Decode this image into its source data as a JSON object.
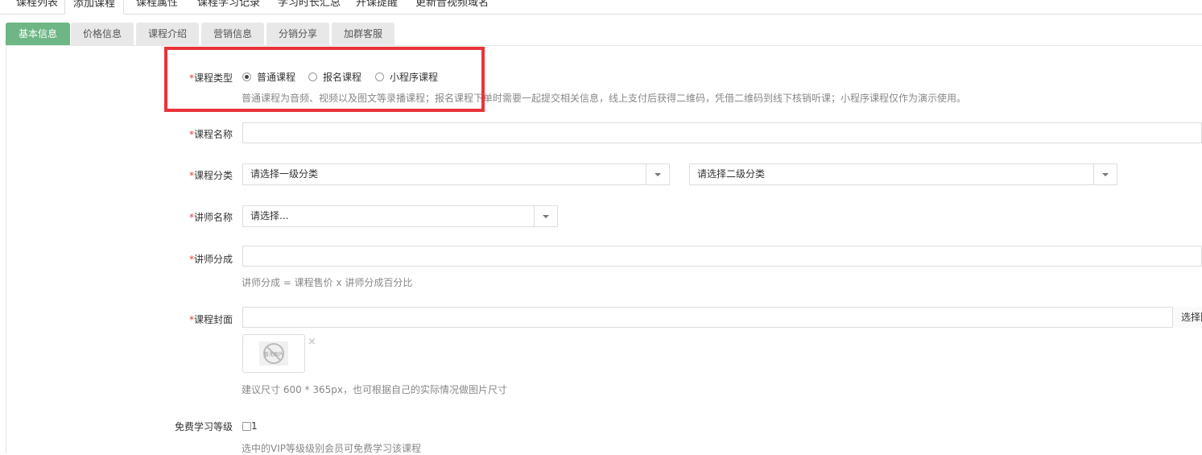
{
  "top_tabs": [
    {
      "label": "课程列表"
    },
    {
      "label": "添加课程"
    },
    {
      "label": "课程属性"
    },
    {
      "label": "课程学习记录"
    },
    {
      "label": "学习时长汇总"
    },
    {
      "label": "开课提醒"
    },
    {
      "label": "更新音视频域名"
    }
  ],
  "sub_tabs": [
    {
      "label": "基本信息"
    },
    {
      "label": "价格信息"
    },
    {
      "label": "课程介绍"
    },
    {
      "label": "营销信息"
    },
    {
      "label": "分销分享"
    },
    {
      "label": "加群客服"
    }
  ],
  "form": {
    "required_mark": "*",
    "course_type": {
      "label": "课程类型",
      "options": [
        "普通课程",
        "报名课程",
        "小程序课程"
      ],
      "selected": "普通课程",
      "help": "普通课程为音频、视频以及图文等录播课程；报名课程下单时需要一起提交相关信息，线上支付后获得二维码，凭借二维码到线下核销听课；小程序课程仅作为演示使用。"
    },
    "course_name": {
      "label": "课程名称",
      "value": ""
    },
    "course_category": {
      "label": "课程分类",
      "level1_placeholder": "请选择一级分类",
      "level2_placeholder": "请选择二级分类"
    },
    "teacher_name": {
      "label": "讲师名称",
      "placeholder": "请选择..."
    },
    "teacher_share": {
      "label": "讲师分成",
      "value": "",
      "help": "讲师分成 = 课程售价 x 讲师分成百分比"
    },
    "course_cover": {
      "label": "课程封面",
      "value": "",
      "select_button": "选择图片",
      "thumb_text": "暂无图片",
      "close_symbol": "×",
      "help": "建议尺寸 600 * 365px，也可根据自己的实际情况做图片尺寸"
    },
    "free_level": {
      "label": "免费学习等级",
      "checkbox_label": "1",
      "checked": false,
      "help": "选中的VIP等级级别会员可免费学习该课程"
    }
  },
  "colors": {
    "active_tab": "#6eb686",
    "required": "#e4393c",
    "highlight": "#e8343a"
  }
}
